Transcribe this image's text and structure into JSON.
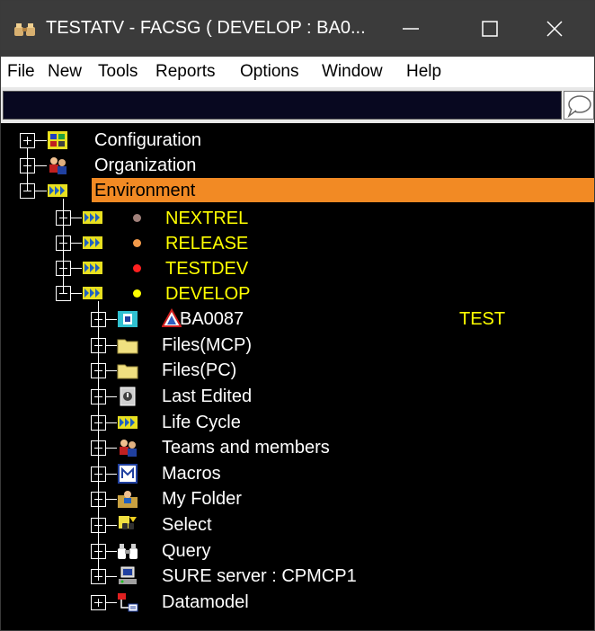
{
  "window": {
    "title": "TESTATV - FACSG ( DEVELOP : BA0...",
    "controls": [
      "minimize",
      "maximize",
      "close"
    ]
  },
  "menu": [
    "File",
    "New",
    "Tools",
    "Reports",
    "Options",
    "Window",
    "Help"
  ],
  "command_bar": {
    "value": ""
  },
  "tree": {
    "roots": [
      {
        "label": "Configuration",
        "icon": "configuration-icon",
        "state": "collapsed"
      },
      {
        "label": "Organization",
        "icon": "organization-icon",
        "state": "collapsed"
      },
      {
        "label": "Environment",
        "icon": "environment-icon",
        "state": "expanded",
        "selected": true
      }
    ],
    "environments": [
      {
        "label": "NEXTREL",
        "dot_color": "#a0807a",
        "state": "collapsed"
      },
      {
        "label": "RELEASE",
        "dot_color": "#f29a4a",
        "state": "collapsed"
      },
      {
        "label": "TESTDEV",
        "dot_color": "#ff2020",
        "state": "collapsed"
      },
      {
        "label": "DEVELOP",
        "dot_color": "#ffff00",
        "state": "expanded"
      }
    ],
    "develop_children": [
      {
        "label": "BA0087",
        "icon": "project-icon",
        "badge": "warning-icon",
        "tag": "TEST"
      },
      {
        "label": "Files(MCP)",
        "icon": "folder-icon"
      },
      {
        "label": "Files(PC)",
        "icon": "folder-icon"
      },
      {
        "label": "Last Edited",
        "icon": "last-edited-icon"
      },
      {
        "label": "Life Cycle",
        "icon": "life-cycle-icon"
      },
      {
        "label": "Teams and members",
        "icon": "teams-icon"
      },
      {
        "label": "Macros",
        "icon": "macros-icon"
      },
      {
        "label": "My Folder",
        "icon": "my-folder-icon"
      },
      {
        "label": "Select",
        "icon": "select-icon"
      },
      {
        "label": "Query",
        "icon": "binoculars-icon"
      },
      {
        "label": "SURE server : CPMCP1",
        "icon": "server-icon"
      },
      {
        "label": "Datamodel",
        "icon": "datamodel-icon"
      }
    ]
  },
  "colors": {
    "tree_bg": "#000000",
    "selection": "#f28a24",
    "env_label": "#ffff00",
    "titlebar": "#3b3b3b"
  }
}
